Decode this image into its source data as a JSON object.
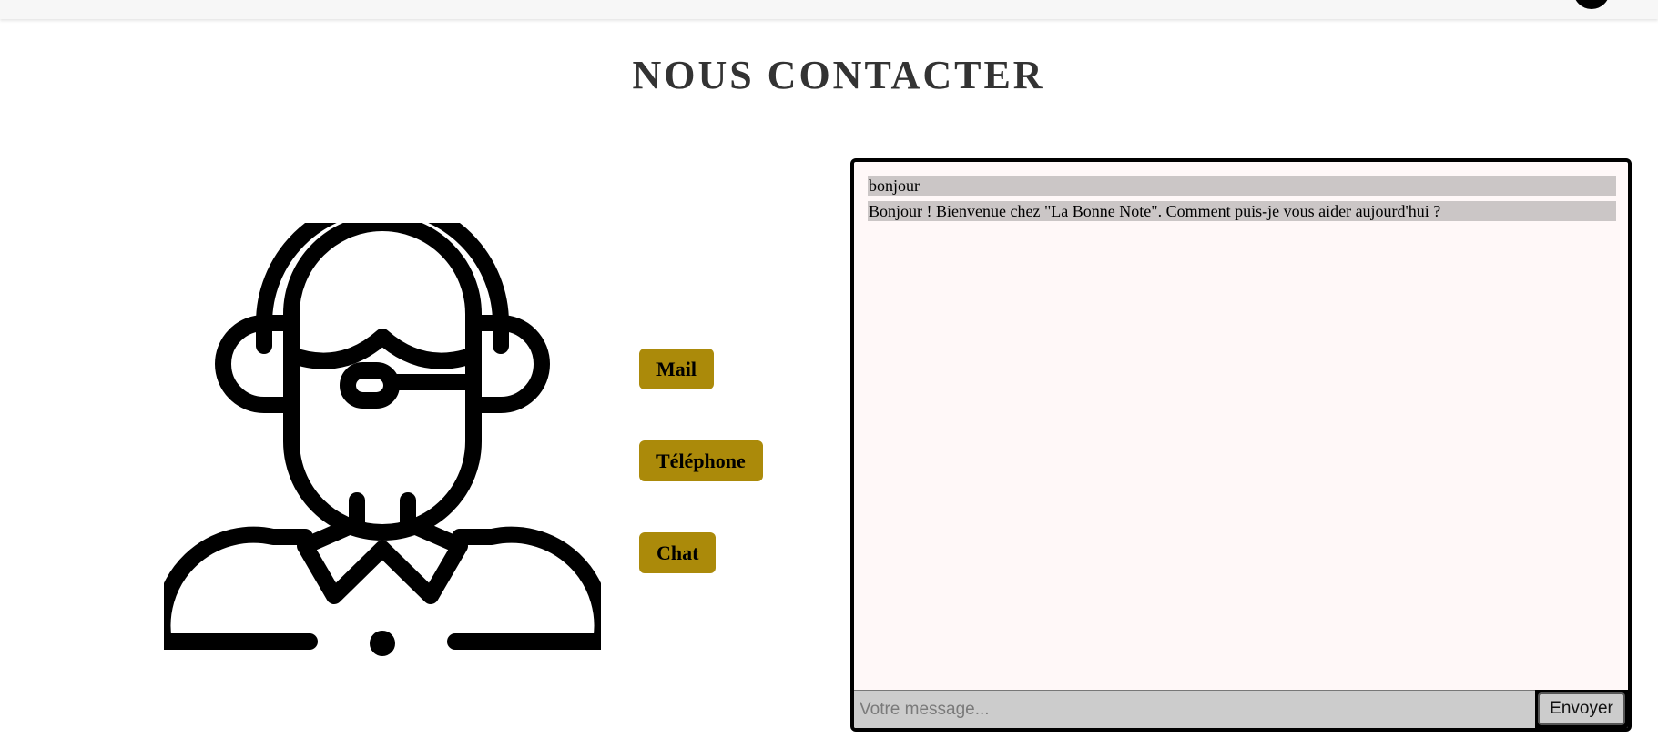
{
  "page": {
    "title": "NOUS CONTACTER"
  },
  "contact_options": {
    "mail": "Mail",
    "phone": "Téléphone",
    "chat": "Chat"
  },
  "chat": {
    "messages": [
      "bonjour",
      "Bonjour ! Bienvenue chez \"La Bonne Note\". Comment puis-je vous aider aujourd'hui ?"
    ],
    "input_placeholder": "Votre message...",
    "input_value": "",
    "send_label": "Envoyer"
  },
  "colors": {
    "accent": "#ab8a0a",
    "chat_background": "#fff8f8",
    "message_background": "#cbc6c6",
    "title": "#333333"
  }
}
